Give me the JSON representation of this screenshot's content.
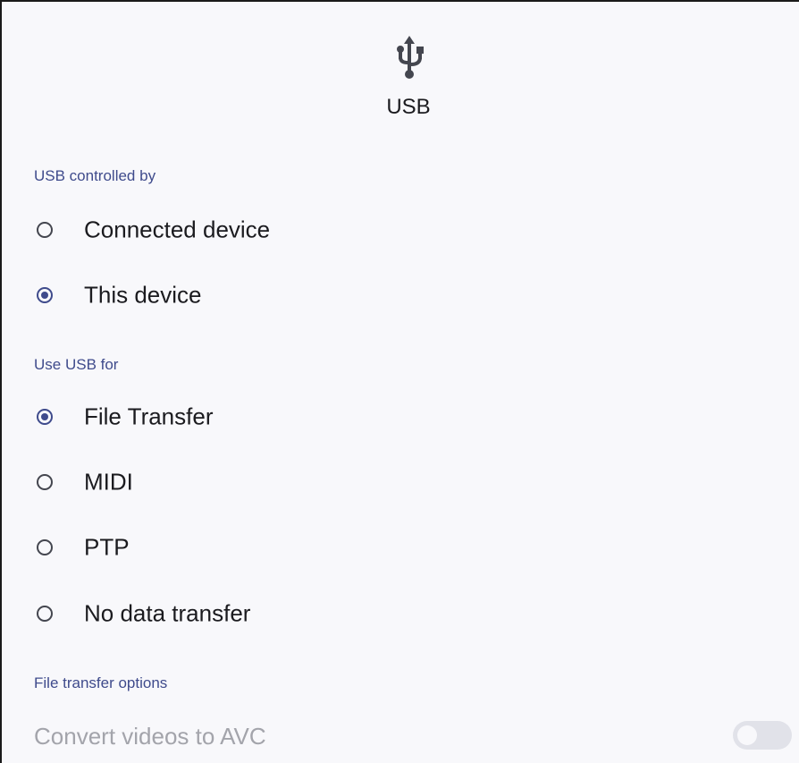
{
  "header": {
    "icon": "usb-icon",
    "title": "USB"
  },
  "usb_controlled_by": {
    "label": "USB controlled by",
    "options": [
      {
        "label": "Connected device",
        "selected": false
      },
      {
        "label": "This device",
        "selected": true
      }
    ]
  },
  "use_usb_for": {
    "label": "Use USB for",
    "options": [
      {
        "label": "File Transfer",
        "selected": true
      },
      {
        "label": "MIDI",
        "selected": false
      },
      {
        "label": "PTP",
        "selected": false
      },
      {
        "label": "No data transfer",
        "selected": false
      }
    ]
  },
  "file_transfer_options": {
    "label": "File transfer options",
    "convert_videos": {
      "label": "Convert videos to AVC",
      "enabled": false,
      "on": false
    }
  },
  "colors": {
    "accent": "#3f4b8c",
    "disabled_text": "#a3a4ab",
    "background": "#f8f8fb"
  }
}
